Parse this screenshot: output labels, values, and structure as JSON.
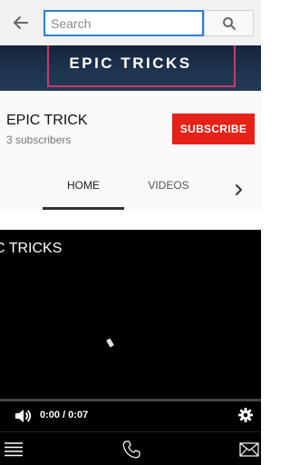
{
  "search": {
    "placeholder": "Search",
    "value": ""
  },
  "banner": {
    "title": "EPIC TRICKS"
  },
  "channel": {
    "name": "EPIC TRICK",
    "subscribers": "3 subscribers",
    "subscribe_label": "SUBSCRIBE"
  },
  "tabs": [
    {
      "label": "HOME",
      "selected": true
    },
    {
      "label": "VIDEOS",
      "selected": false
    }
  ],
  "video": {
    "title": "C TRICKS",
    "time": "0:00 / 0:07",
    "progress": 0.0
  },
  "icons": {
    "back": "arrow-left-icon",
    "search": "search-icon",
    "more": "chevron-right-icon",
    "volume": "volume-icon",
    "settings": "gear-icon",
    "menu": "hamburger-menu-icon",
    "phone": "phone-icon",
    "mail": "mail-icon"
  },
  "colors": {
    "accent": "#2a7fd4",
    "subscribe": "#e62117",
    "banner_frame": "#c83b6b"
  }
}
